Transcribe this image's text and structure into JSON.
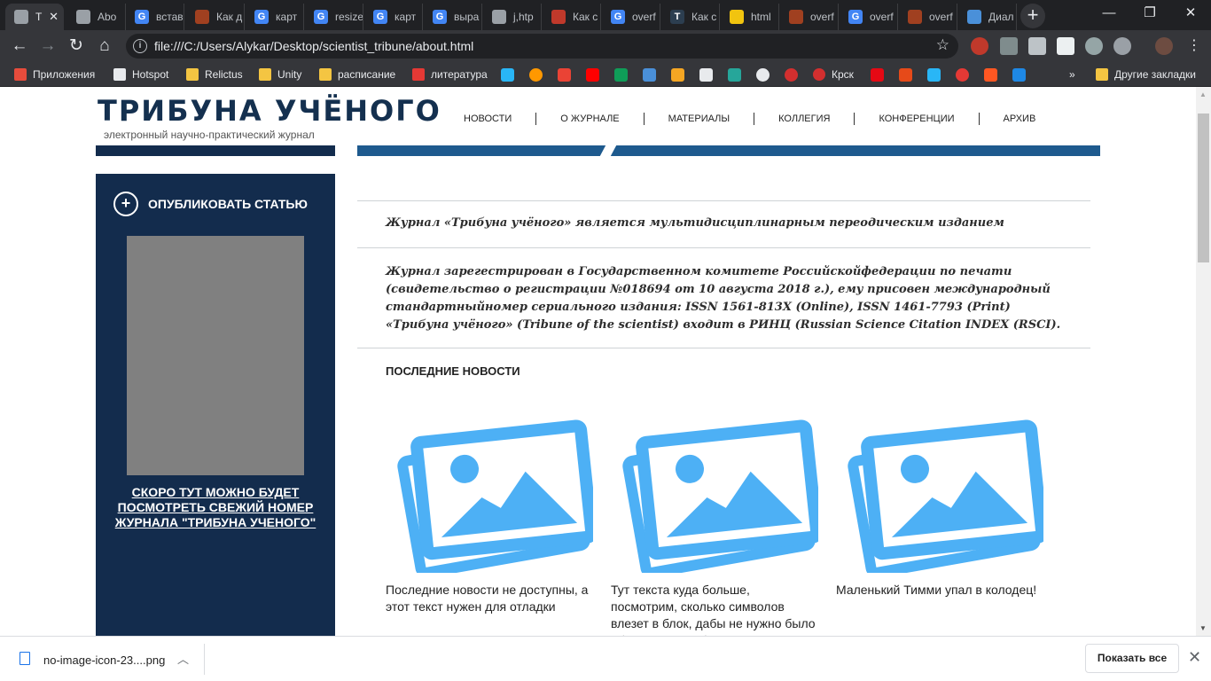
{
  "browser": {
    "tabs": [
      {
        "title": "Т",
        "color": "#9aa0a6",
        "active": true
      },
      {
        "title": "Abo",
        "color": "#9aa0a6"
      },
      {
        "title": "встав",
        "color": "#4285f4",
        "icon": "G"
      },
      {
        "title": "Как д",
        "color": "#a04020"
      },
      {
        "title": "карт",
        "color": "#4285f4",
        "icon": "G"
      },
      {
        "title": "resize",
        "color": "#4285f4",
        "icon": "G"
      },
      {
        "title": "карт",
        "color": "#4285f4",
        "icon": "G"
      },
      {
        "title": "выра",
        "color": "#4285f4",
        "icon": "G"
      },
      {
        "title": "j,htp",
        "color": "#9aa0a6"
      },
      {
        "title": "Как с",
        "color": "#c0392b"
      },
      {
        "title": "overf",
        "color": "#4285f4",
        "icon": "G"
      },
      {
        "title": "Как с",
        "color": "#2c3e50",
        "icon": "T"
      },
      {
        "title": "html",
        "color": "#f1c40f"
      },
      {
        "title": "overf",
        "color": "#a04020"
      },
      {
        "title": "overf",
        "color": "#4285f4",
        "icon": "G"
      },
      {
        "title": "overf",
        "color": "#a04020"
      },
      {
        "title": "Диал",
        "color": "#4a90d9"
      }
    ],
    "address": "file:///C:/Users/Alykar/Desktop/scientist_tribune/about.html",
    "bookmarks": [
      {
        "label": "Приложения",
        "color": "#e74c3c"
      },
      {
        "label": "Hotspot",
        "color": "#e8eaed"
      },
      {
        "label": "Relictus",
        "color": "#f4c542"
      },
      {
        "label": "Unity",
        "color": "#f4c542"
      },
      {
        "label": "расписание",
        "color": "#f4c542"
      },
      {
        "label": "литература",
        "color": "#e53935"
      },
      {
        "label": "Крск",
        "color": "#d32f2f"
      }
    ],
    "other_bookmarks": "Другие закладки"
  },
  "site": {
    "logo": "ТРИБУНА УЧЁНОГО",
    "tagline": "электронный научно-практический журнал",
    "nav": [
      "НОВОСТИ",
      "О ЖУРНАЛЕ",
      "МАТЕРИАЛЫ",
      "КОЛЛЕГИЯ",
      "КОНФЕРЕНЦИИ",
      "АРХИВ"
    ]
  },
  "sidebar": {
    "publish": "ОПУБЛИКОВАТЬ СТАТЬЮ",
    "soon": "СКОРО ТУТ МОЖНО БУДЕТ ПОСМОТРЕТЬ СВЕЖИЙ НОМЕР ЖУРНАЛА \"ТРИБУНА УЧЕНОГО\""
  },
  "content": {
    "intro": "Журнал «Трибуна учёного» является мультидисциплинарным переодическим изданием",
    "registration": "Журнал зарегестрирован в Государственном комитете Российскойфедерации по печати (свидетельство о регистрации №018694 от 10 августа 2018 г.), ему присовен международный стандартныйномер сериального издания: ISSN 1561-813X (Online), ISSN 1461-7793 (Print) «Трибуна учёного» (Tribune of the scientist) входит в РИНЦ (Russian Science Citation INDEX (RSCI).",
    "news_title": "ПОСЛЕДНИЕ НОВОСТИ",
    "news": [
      {
        "text": "Последние новости не доступны, а этот текст нужен для отладки"
      },
      {
        "text": "Тут текста куда больше, посмотрим, сколько символов влезет в блок, дабы не нужно было обрезать все, обрезать"
      },
      {
        "text": "Маленький Тимми упал в колодец!"
      }
    ]
  },
  "downloads": {
    "file": "no-image-icon-23....png",
    "show_all": "Показать все"
  }
}
